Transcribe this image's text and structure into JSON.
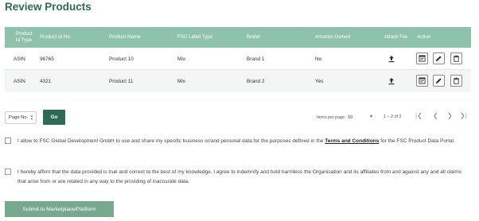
{
  "page": {
    "title": "Review Products"
  },
  "table": {
    "columns": {
      "product_id_type": "Product Id Type",
      "product_id_no": "Product Id No.",
      "product_name": "Product Name",
      "fsc_label_type": "FSC Label Type",
      "brand": "Brand",
      "amazon_owned": "Amazon Owned",
      "attach_file": "Attach File",
      "action": "Action"
    },
    "rows": [
      {
        "id_type": "ASIN",
        "id_no": "96765",
        "name": "Product 10",
        "label_type": "Mix",
        "brand": "Brand 1",
        "amazon_owned": "No"
      },
      {
        "id_type": "ASIN",
        "id_no": "4321",
        "name": "Product 11",
        "label_type": "Mix",
        "brand": "Brand 2",
        "amazon_owned": "Yes"
      }
    ],
    "icons": {
      "attach": "upload-icon",
      "actions": [
        "details-icon",
        "edit-icon",
        "delete-icon"
      ]
    }
  },
  "pagination": {
    "page_no_label": "Page No.",
    "go_label": "Go",
    "items_per_page_label": "Items per page:",
    "items_per_page_value": "10",
    "range_label": "1 – 2 of 2",
    "nav": {
      "first": "|❮",
      "prev": "❮",
      "next": "❯",
      "last": "❯|"
    }
  },
  "consents": {
    "data_use": {
      "before": "I allow to FSC Global Development GmbH to use and share my specific business or/and personal data for the purposes defined in the ",
      "link": "Terms and Conditions",
      "after": " for the FSC Product Data Portal."
    },
    "affirm": "I hereby affirm that the data provided is true and correct to the best of my knowledge. I agree to indemnify and hold harmless the Organisation and its affiliates from and against any and all claims that arise from or are related in any way to the providing of inaccurate data."
  },
  "submit_label": "Submit to Marketplace/Platform",
  "colors": {
    "brand": "#2e6b55",
    "header": "#8ec2ad",
    "submit": "#78a98e"
  }
}
